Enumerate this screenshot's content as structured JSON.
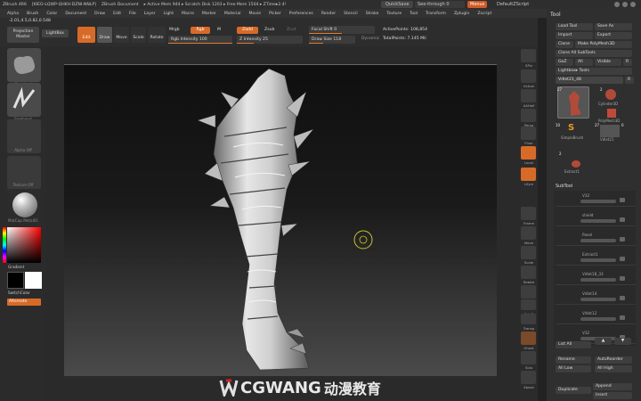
{
  "titlebar": {
    "items": [
      "ZBrush 4R6",
      "[KIEO-LQWP-QHKH-DZNI-NNLP]",
      "ZBrush Document",
      "▸ Active Mem 944 ▸ Scratch Disk 1203 ▸ Free Mem 1504 ▸ ZTime▸2.4!"
    ],
    "quicksave": "QuickSave",
    "see_through": "See-through 0",
    "menus": "Menus",
    "default_script": "DefaultZScript"
  },
  "menubar": [
    "Alpha",
    "Brush",
    "Color",
    "Document",
    "Draw",
    "Edit",
    "File",
    "Layer",
    "Light",
    "Macro",
    "Marker",
    "Material",
    "Movie",
    "Picker",
    "Preferences",
    "Render",
    "Stencil",
    "Stroke",
    "Texture",
    "Tool",
    "Transform",
    "Zplugin",
    "Zscript"
  ],
  "shelf": {
    "coords": "-2.01,4.5,0.82,0.548",
    "projection_master": "Projection Master",
    "lightbox": "LightBox",
    "edit": "Edit",
    "draw": "Draw",
    "move": "Move",
    "scale": "Scale",
    "rotate": "Rotate",
    "mrgb": "Mrgb",
    "rgb": "Rgb",
    "m": "M",
    "rgb_intensity": "Rgb Intensity 100",
    "zadd": "Zadd",
    "zsub": "Zsub",
    "zcut": "Zcut",
    "z_intensity": "Z Intensity 25",
    "focal_shift": "Focal Shift 0",
    "draw_size": "Draw Size 118",
    "dynamic": "Dynamic",
    "active_points": "ActivePoints: 108,854",
    "total_points": "TotalPoints: 7.145 Mil"
  },
  "left": {
    "tiles": [
      "Standard",
      "Freehand",
      "Alpha Off",
      "Texture Off",
      "MatCap Metal01"
    ],
    "gradient": "Gradient",
    "switchcolor": "SwitchColor",
    "alternate": "Alternate",
    "accent": "#e07b2c"
  },
  "right_shelf": [
    "SPix",
    "Actual",
    "AAHalf",
    "Persp",
    "Floor",
    "Local",
    "LSym",
    "Frame",
    "Move",
    "Scale",
    "Rotate",
    "Line Fill",
    "PolyF",
    "Transp",
    "Ghost",
    "Solo",
    "Xpose"
  ],
  "tool": {
    "title": "Tool",
    "load": "Load Tool",
    "save": "Save As",
    "import": "Import",
    "export": "Export",
    "clone": "Clone",
    "make_polymesh": "Make PolyMesh3D",
    "clone_all": "Clone All SubTools",
    "goz": "GoZ",
    "all": "All",
    "visible": "Visible",
    "r": "R",
    "lightbox_tools": "Lightbox▸ Tools",
    "current": "Vdlet21_48",
    "count": "R",
    "thumbs": [
      "Cylinder3D",
      "PolyMesh3D",
      "SimpleBrush",
      "Vdlet21",
      "Extract1"
    ],
    "thumb_nums": [
      "27",
      "2",
      "10",
      "27",
      "0",
      "2"
    ],
    "subtool_title": "SubTool",
    "subtools": [
      "V32",
      "shield",
      "Panel",
      "Extract1",
      "Vdlet18_33",
      "Vdlet14",
      "Vdlet12",
      "V32"
    ],
    "list_all": "List All",
    "rename": "Rename",
    "autoreorder": "AutoReorder",
    "all_low": "All Low",
    "all_high": "All High",
    "duplicate": "Duplicate",
    "append": "Append",
    "insert": "Insert"
  },
  "brand": {
    "name": "CGWANG",
    "chinese": "动漫教育"
  }
}
